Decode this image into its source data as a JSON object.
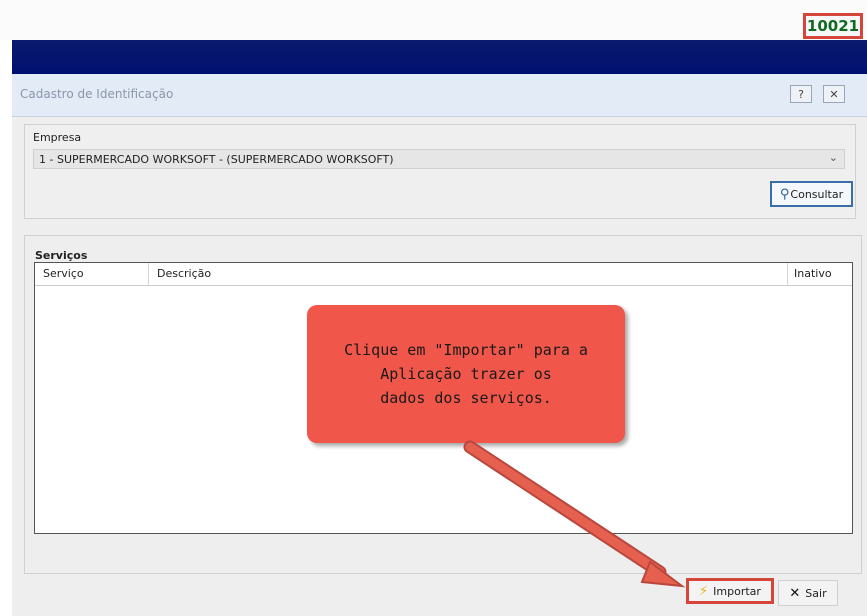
{
  "header": {
    "code": "10021"
  },
  "window": {
    "title": "Cadastro de Identificação",
    "help_icon": "question-mark-icon",
    "close_icon": "close-icon"
  },
  "empresa": {
    "label": "Empresa",
    "selected": "1 - SUPERMERCADO WORKSOFT - (SUPERMERCADO WORKSOFT)",
    "consult_label": "Consultar"
  },
  "servicos": {
    "label": "Serviços",
    "columns": [
      "Serviço",
      "Descrição",
      "Inativo"
    ],
    "rows": []
  },
  "callout": {
    "text": "Clique em \"Importar\" para a\nAplicação trazer os\ndados dos serviços."
  },
  "buttons": {
    "import_label": "Importar",
    "exit_label": "Sair"
  },
  "colors": {
    "navy": "#001070",
    "callout": "#f0574a",
    "highlight": "#d6453a",
    "code_text": "#0f6a22"
  }
}
